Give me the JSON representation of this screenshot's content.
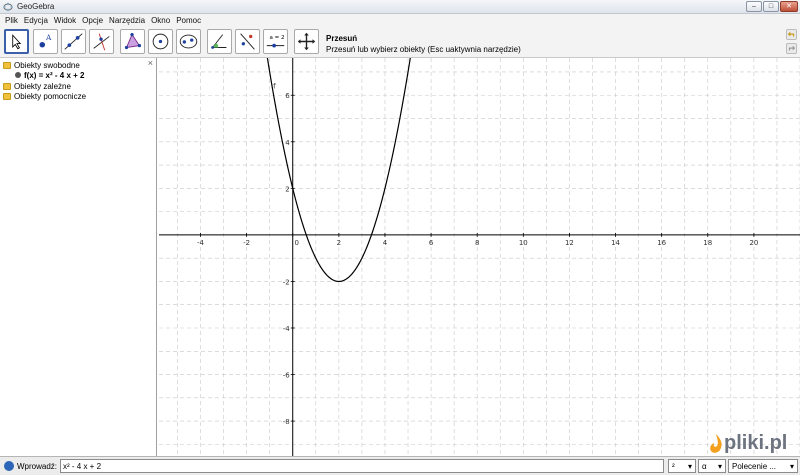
{
  "window": {
    "title": "GeoGebra"
  },
  "menu": [
    "Plik",
    "Edycja",
    "Widok",
    "Opcje",
    "Narzędzia",
    "Okno",
    "Pomoc"
  ],
  "toolbar": {
    "active_tool_name": "Przesuń",
    "active_tool_help": "Przesuń lub wybierz obiekty (Esc uaktywnia narzędzie)",
    "slider_tool_text": "a = 2"
  },
  "algebra": {
    "folders": [
      "Obiekty swobodne",
      "Obiekty zależne",
      "Obiekty pomocnicze"
    ],
    "free_objects": [
      "f(x) = x² - 4 x + 2"
    ],
    "close_symbol": "×"
  },
  "graphics": {
    "function_label": "f",
    "x_tick_labels": [
      "-4",
      "-2",
      "0",
      "2",
      "4",
      "6",
      "8",
      "10",
      "12",
      "14",
      "16",
      "18",
      "20"
    ],
    "y_tick_labels": [
      "6",
      "4",
      "2",
      "-2",
      "-4",
      "-6",
      "-8"
    ],
    "chart_data": {
      "type": "line",
      "series": [
        {
          "name": "f",
          "formula": "x^2 - 4x + 2"
        }
      ],
      "xlim": [
        -5.8,
        22
      ],
      "ylim": [
        -9.5,
        7.6
      ],
      "grid": true,
      "xticks": [
        -4,
        -2,
        0,
        2,
        4,
        6,
        8,
        10,
        12,
        14,
        16,
        18,
        20
      ],
      "yticks": [
        -8,
        -6,
        -4,
        -2,
        2,
        4,
        6
      ]
    }
  },
  "input": {
    "label": "Wprowadź:",
    "value": "x² - 4 x + 2",
    "combo_symbols": "²",
    "combo_greek": "α",
    "combo_commands": "Polecenie ..."
  },
  "watermark": {
    "text": "pliki.pl"
  },
  "colors": {
    "accent": "#3b5fa8",
    "curve": "#000000",
    "grid": "#c8c8c8",
    "folder": "#f0c23c"
  }
}
